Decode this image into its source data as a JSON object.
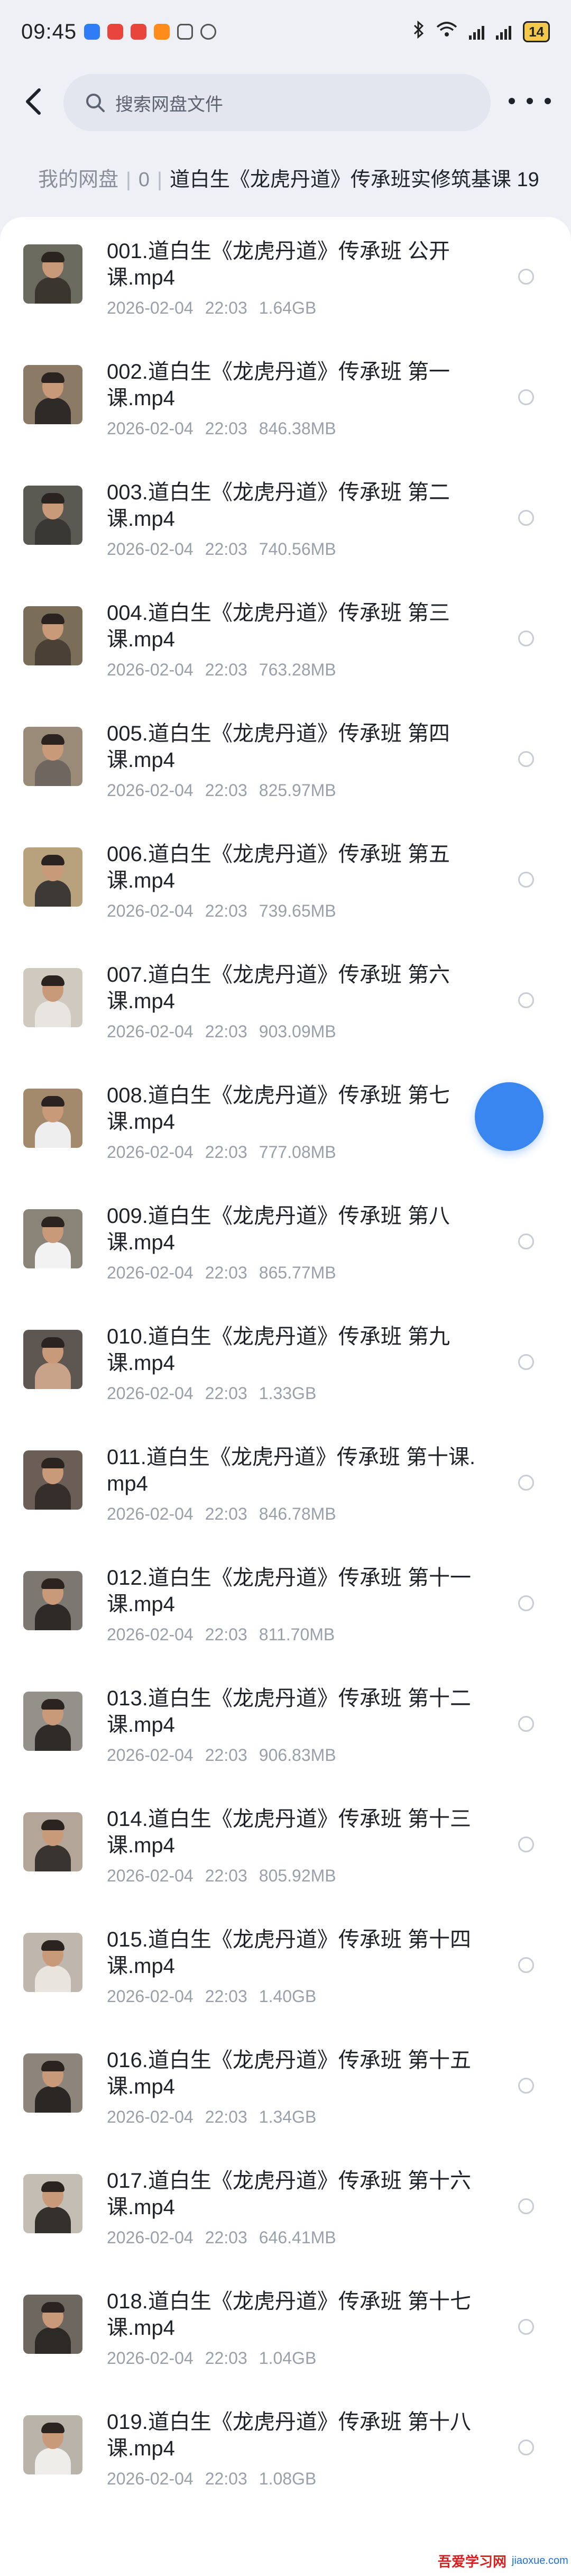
{
  "status_bar": {
    "time": "09:45",
    "battery": "14",
    "app_icon_colors": [
      "#2f7cf6",
      "#e8453c",
      "#e8453c",
      "#ff8c1a",
      "#555555",
      "#555555"
    ]
  },
  "header": {
    "back_icon": "chevron-left-icon",
    "search_placeholder": "搜索网盘文件",
    "more_icon": "more-dots-icon"
  },
  "breadcrumb": {
    "root": "我的网盘",
    "level1": "0",
    "current": "道白生《龙虎丹道》传承班实修筑基课 19"
  },
  "files": [
    {
      "name": "001.道白生《龙虎丹道》传承班 公开课.mp4",
      "date": "2026-02-04",
      "time": "22:03",
      "size": "1.64GB"
    },
    {
      "name": "002.道白生《龙虎丹道》传承班 第一课.mp4",
      "date": "2026-02-04",
      "time": "22:03",
      "size": "846.38MB"
    },
    {
      "name": "003.道白生《龙虎丹道》传承班 第二课.mp4",
      "date": "2026-02-04",
      "time": "22:03",
      "size": "740.56MB"
    },
    {
      "name": "004.道白生《龙虎丹道》传承班 第三课.mp4",
      "date": "2026-02-04",
      "time": "22:03",
      "size": "763.28MB"
    },
    {
      "name": "005.道白生《龙虎丹道》传承班 第四课.mp4",
      "date": "2026-02-04",
      "time": "22:03",
      "size": "825.97MB"
    },
    {
      "name": "006.道白生《龙虎丹道》传承班 第五课.mp4",
      "date": "2026-02-04",
      "time": "22:03",
      "size": "739.65MB"
    },
    {
      "name": "007.道白生《龙虎丹道》传承班 第六课.mp4",
      "date": "2026-02-04",
      "time": "22:03",
      "size": "903.09MB"
    },
    {
      "name": "008.道白生《龙虎丹道》传承班 第七课.mp4",
      "date": "2026-02-04",
      "time": "22:03",
      "size": "777.08MB"
    },
    {
      "name": "009.道白生《龙虎丹道》传承班 第八课.mp4",
      "date": "2026-02-04",
      "time": "22:03",
      "size": "865.77MB"
    },
    {
      "name": "010.道白生《龙虎丹道》传承班 第九课.mp4",
      "date": "2026-02-04",
      "time": "22:03",
      "size": "1.33GB"
    },
    {
      "name": "011.道白生《龙虎丹道》传承班 第十课.mp4",
      "date": "2026-02-04",
      "time": "22:03",
      "size": "846.78MB"
    },
    {
      "name": "012.道白生《龙虎丹道》传承班 第十一课.mp4",
      "date": "2026-02-04",
      "time": "22:03",
      "size": "811.70MB"
    },
    {
      "name": "013.道白生《龙虎丹道》传承班 第十二课.mp4",
      "date": "2026-02-04",
      "time": "22:03",
      "size": "906.83MB"
    },
    {
      "name": "014.道白生《龙虎丹道》传承班 第十三课.mp4",
      "date": "2026-02-04",
      "time": "22:03",
      "size": "805.92MB"
    },
    {
      "name": "015.道白生《龙虎丹道》传承班 第十四课.mp4",
      "date": "2026-02-04",
      "time": "22:03",
      "size": "1.40GB"
    },
    {
      "name": "016.道白生《龙虎丹道》传承班 第十五课.mp4",
      "date": "2026-02-04",
      "time": "22:03",
      "size": "1.34GB"
    },
    {
      "name": "017.道白生《龙虎丹道》传承班 第十六课.mp4",
      "date": "2026-02-04",
      "time": "22:03",
      "size": "646.41MB"
    },
    {
      "name": "018.道白生《龙虎丹道》传承班 第十七课.mp4",
      "date": "2026-02-04",
      "time": "22:03",
      "size": "1.04GB"
    },
    {
      "name": "019.道白生《龙虎丹道》传承班 第十八课.mp4",
      "date": "2026-02-04",
      "time": "22:03",
      "size": "1.08GB"
    }
  ],
  "floating_button": {
    "color": "#3a86f0"
  },
  "watermark": {
    "text_cn": "吾爱学习网",
    "text_en": "jiaoxue.com"
  }
}
